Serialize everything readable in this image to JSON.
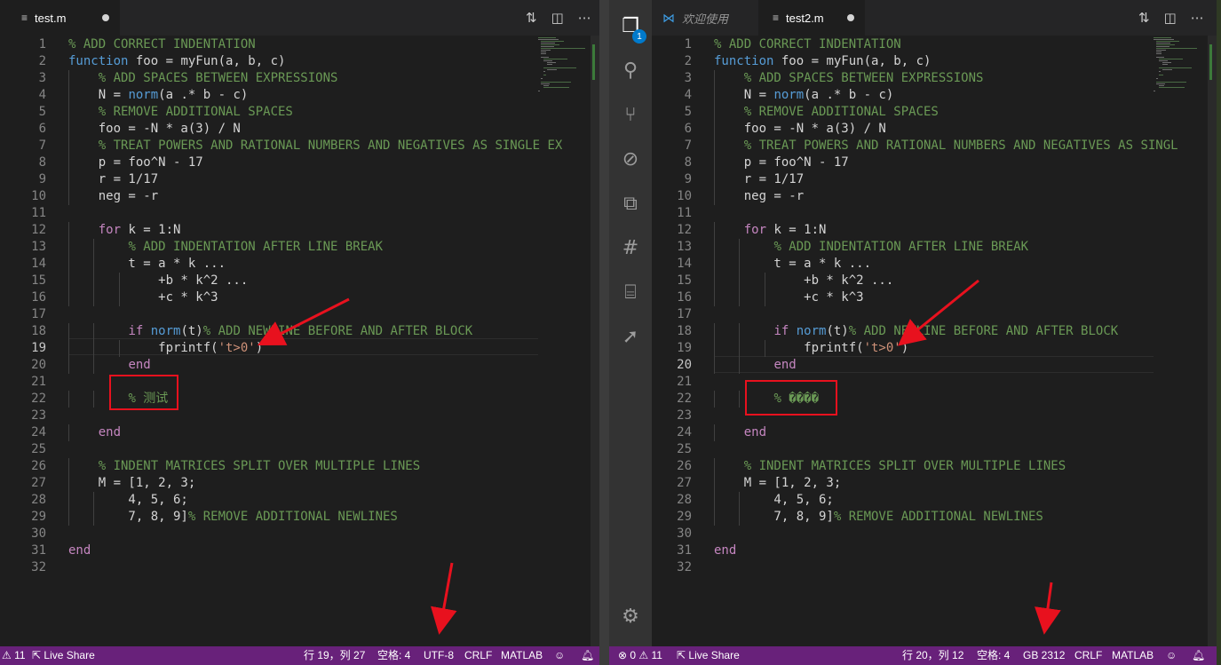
{
  "left": {
    "tab": {
      "file": "test.m"
    },
    "current_line": 19,
    "lines": [
      {
        "n": "1",
        "parts": [
          [
            "cm",
            "% ADD CORRECT INDENTATION"
          ]
        ]
      },
      {
        "n": "2",
        "parts": [
          [
            "fn",
            "function"
          ],
          [
            "tx",
            " foo = myFun(a, b, c)"
          ]
        ]
      },
      {
        "n": "3",
        "parts": [
          [
            "tx",
            "    "
          ],
          [
            "cm",
            "% ADD SPACES BETWEEN EXPRESSIONS"
          ]
        ]
      },
      {
        "n": "4",
        "parts": [
          [
            "tx",
            "    N = "
          ],
          [
            "fn",
            "norm"
          ],
          [
            "tx",
            "(a .* b - c)"
          ]
        ]
      },
      {
        "n": "5",
        "parts": [
          [
            "tx",
            "    "
          ],
          [
            "cm",
            "% REMOVE ADDITIONAL SPACES"
          ]
        ]
      },
      {
        "n": "6",
        "parts": [
          [
            "tx",
            "    foo = -N * a(3) / N"
          ]
        ]
      },
      {
        "n": "7",
        "parts": [
          [
            "tx",
            "    "
          ],
          [
            "cm",
            "% TREAT POWERS AND RATIONAL NUMBERS AND NEGATIVES AS SINGLE EX"
          ]
        ]
      },
      {
        "n": "8",
        "parts": [
          [
            "tx",
            "    p = foo^N - 17"
          ]
        ]
      },
      {
        "n": "9",
        "parts": [
          [
            "tx",
            "    r = 1/17"
          ]
        ]
      },
      {
        "n": "10",
        "parts": [
          [
            "tx",
            "    neg = -r"
          ]
        ]
      },
      {
        "n": "11",
        "parts": [
          [
            "tx",
            ""
          ]
        ]
      },
      {
        "n": "12",
        "parts": [
          [
            "tx",
            "    "
          ],
          [
            "kw",
            "for"
          ],
          [
            "tx",
            " k = 1:N"
          ]
        ]
      },
      {
        "n": "13",
        "parts": [
          [
            "tx",
            "        "
          ],
          [
            "cm",
            "% ADD INDENTATION AFTER LINE BREAK"
          ]
        ]
      },
      {
        "n": "14",
        "parts": [
          [
            "tx",
            "        t = a * k ..."
          ]
        ]
      },
      {
        "n": "15",
        "parts": [
          [
            "tx",
            "            +b * k^2 ..."
          ]
        ]
      },
      {
        "n": "16",
        "parts": [
          [
            "tx",
            "            +c * k^3"
          ]
        ]
      },
      {
        "n": "17",
        "parts": [
          [
            "tx",
            ""
          ]
        ]
      },
      {
        "n": "18",
        "parts": [
          [
            "tx",
            "        "
          ],
          [
            "kw",
            "if"
          ],
          [
            "tx",
            " "
          ],
          [
            "fn",
            "norm"
          ],
          [
            "tx",
            "(t)"
          ],
          [
            "cm",
            "% ADD NEWLINE BEFORE AND AFTER BLOCK"
          ]
        ]
      },
      {
        "n": "19",
        "parts": [
          [
            "tx",
            "            fprintf("
          ],
          [
            "st",
            "'t>0'"
          ],
          [
            "tx",
            ")"
          ]
        ]
      },
      {
        "n": "20",
        "parts": [
          [
            "tx",
            "        "
          ],
          [
            "kw",
            "end"
          ]
        ]
      },
      {
        "n": "21",
        "parts": [
          [
            "tx",
            ""
          ]
        ]
      },
      {
        "n": "22",
        "parts": [
          [
            "tx",
            "        "
          ],
          [
            "cm",
            "% 测试"
          ]
        ]
      },
      {
        "n": "23",
        "parts": [
          [
            "tx",
            ""
          ]
        ]
      },
      {
        "n": "24",
        "parts": [
          [
            "tx",
            "    "
          ],
          [
            "kw",
            "end"
          ]
        ]
      },
      {
        "n": "25",
        "parts": [
          [
            "tx",
            ""
          ]
        ]
      },
      {
        "n": "26",
        "parts": [
          [
            "tx",
            "    "
          ],
          [
            "cm",
            "% INDENT MATRICES SPLIT OVER MULTIPLE LINES"
          ]
        ]
      },
      {
        "n": "27",
        "parts": [
          [
            "tx",
            "    M = [1, 2, 3;"
          ]
        ]
      },
      {
        "n": "28",
        "parts": [
          [
            "tx",
            "        4, 5, 6;"
          ]
        ]
      },
      {
        "n": "29",
        "parts": [
          [
            "tx",
            "        7, 8, 9]"
          ],
          [
            "cm",
            "% REMOVE ADDITIONAL NEWLINES"
          ]
        ]
      },
      {
        "n": "30",
        "parts": [
          [
            "tx",
            ""
          ]
        ]
      },
      {
        "n": "31",
        "parts": [
          [
            "kw",
            "end"
          ]
        ]
      },
      {
        "n": "32",
        "parts": [
          [
            "tx",
            ""
          ]
        ]
      }
    ],
    "status": {
      "problems": "11",
      "live_share": "Live Share",
      "position": "行 19，列 27",
      "spaces": "空格: 4",
      "encoding": "UTF-8",
      "eol": "CRLF",
      "language": "MATLAB"
    }
  },
  "right": {
    "tabs": {
      "welcome": "欢迎使用",
      "file": "test2.m"
    },
    "current_line": 20,
    "lines": [
      {
        "n": "1",
        "parts": [
          [
            "cm",
            "% ADD CORRECT INDENTATION"
          ]
        ]
      },
      {
        "n": "2",
        "parts": [
          [
            "fn",
            "function"
          ],
          [
            "tx",
            " foo = myFun(a, b, c)"
          ]
        ]
      },
      {
        "n": "3",
        "parts": [
          [
            "tx",
            "    "
          ],
          [
            "cm",
            "% ADD SPACES BETWEEN EXPRESSIONS"
          ]
        ]
      },
      {
        "n": "4",
        "parts": [
          [
            "tx",
            "    N = "
          ],
          [
            "fn",
            "norm"
          ],
          [
            "tx",
            "(a .* b - c)"
          ]
        ]
      },
      {
        "n": "5",
        "parts": [
          [
            "tx",
            "    "
          ],
          [
            "cm",
            "% REMOVE ADDITIONAL SPACES"
          ]
        ]
      },
      {
        "n": "6",
        "parts": [
          [
            "tx",
            "    foo = -N * a(3) / N"
          ]
        ]
      },
      {
        "n": "7",
        "parts": [
          [
            "tx",
            "    "
          ],
          [
            "cm",
            "% TREAT POWERS AND RATIONAL NUMBERS AND NEGATIVES AS SINGL"
          ]
        ]
      },
      {
        "n": "8",
        "parts": [
          [
            "tx",
            "    p = foo^N - 17"
          ]
        ]
      },
      {
        "n": "9",
        "parts": [
          [
            "tx",
            "    r = 1/17"
          ]
        ]
      },
      {
        "n": "10",
        "parts": [
          [
            "tx",
            "    neg = -r"
          ]
        ]
      },
      {
        "n": "11",
        "parts": [
          [
            "tx",
            ""
          ]
        ]
      },
      {
        "n": "12",
        "parts": [
          [
            "tx",
            "    "
          ],
          [
            "kw",
            "for"
          ],
          [
            "tx",
            " k = 1:N"
          ]
        ]
      },
      {
        "n": "13",
        "parts": [
          [
            "tx",
            "        "
          ],
          [
            "cm",
            "% ADD INDENTATION AFTER LINE BREAK"
          ]
        ]
      },
      {
        "n": "14",
        "parts": [
          [
            "tx",
            "        t = a * k ..."
          ]
        ]
      },
      {
        "n": "15",
        "parts": [
          [
            "tx",
            "            +b * k^2 ..."
          ]
        ]
      },
      {
        "n": "16",
        "parts": [
          [
            "tx",
            "            +c * k^3"
          ]
        ]
      },
      {
        "n": "17",
        "parts": [
          [
            "tx",
            ""
          ]
        ]
      },
      {
        "n": "18",
        "parts": [
          [
            "tx",
            "        "
          ],
          [
            "kw",
            "if"
          ],
          [
            "tx",
            " "
          ],
          [
            "fn",
            "norm"
          ],
          [
            "tx",
            "(t)"
          ],
          [
            "cm",
            "% ADD NEWLINE BEFORE AND AFTER BLOCK"
          ]
        ]
      },
      {
        "n": "19",
        "parts": [
          [
            "tx",
            "            fprintf("
          ],
          [
            "st",
            "'t>0'"
          ],
          [
            "tx",
            ")"
          ]
        ]
      },
      {
        "n": "20",
        "parts": [
          [
            "tx",
            "        "
          ],
          [
            "kw",
            "end"
          ]
        ]
      },
      {
        "n": "21",
        "parts": [
          [
            "tx",
            ""
          ]
        ]
      },
      {
        "n": "22",
        "parts": [
          [
            "tx",
            "        "
          ],
          [
            "cm",
            "% ����"
          ]
        ]
      },
      {
        "n": "23",
        "parts": [
          [
            "tx",
            ""
          ]
        ]
      },
      {
        "n": "24",
        "parts": [
          [
            "tx",
            "    "
          ],
          [
            "kw",
            "end"
          ]
        ]
      },
      {
        "n": "25",
        "parts": [
          [
            "tx",
            ""
          ]
        ]
      },
      {
        "n": "26",
        "parts": [
          [
            "tx",
            "    "
          ],
          [
            "cm",
            "% INDENT MATRICES SPLIT OVER MULTIPLE LINES"
          ]
        ]
      },
      {
        "n": "27",
        "parts": [
          [
            "tx",
            "    M = [1, 2, 3;"
          ]
        ]
      },
      {
        "n": "28",
        "parts": [
          [
            "tx",
            "        4, 5, 6;"
          ]
        ]
      },
      {
        "n": "29",
        "parts": [
          [
            "tx",
            "        7, 8, 9]"
          ],
          [
            "cm",
            "% REMOVE ADDITIONAL NEWLINES"
          ]
        ]
      },
      {
        "n": "30",
        "parts": [
          [
            "tx",
            ""
          ]
        ]
      },
      {
        "n": "31",
        "parts": [
          [
            "kw",
            "end"
          ]
        ]
      },
      {
        "n": "32",
        "parts": [
          [
            "tx",
            ""
          ]
        ]
      }
    ],
    "status": {
      "errors": "0",
      "problems": "11",
      "live_share": "Live Share",
      "position": "行 20，列 12",
      "spaces": "空格: 4",
      "encoding": "GB 2312",
      "eol": "CRLF",
      "language": "MATLAB"
    },
    "explorer_badge": "1"
  },
  "colors": {
    "status_bar": "#68217a",
    "editor_bg": "#1e1e1e",
    "comment": "#6a9955",
    "keyword": "#c586c0",
    "function": "#569cd6",
    "string": "#ce9178",
    "annotation": "#e8111e"
  }
}
